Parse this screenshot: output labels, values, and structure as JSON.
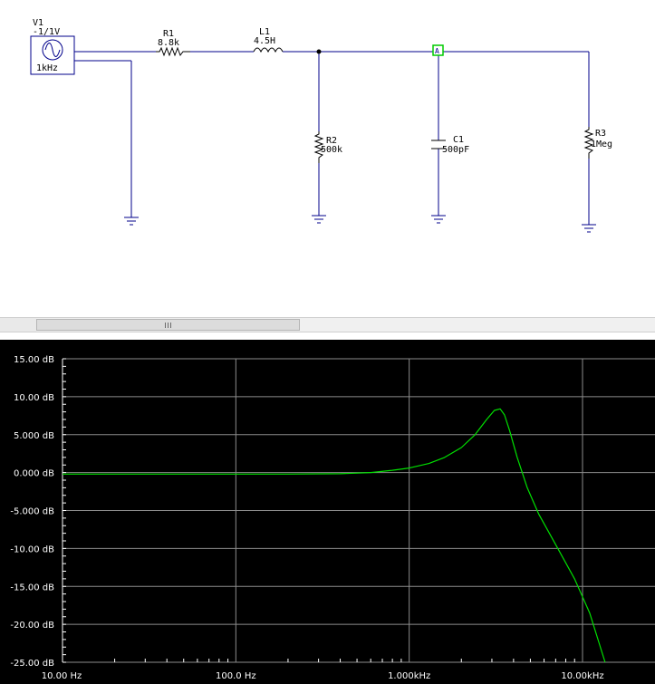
{
  "schematic": {
    "source": {
      "name": "V1",
      "value": "-1/1V",
      "freq": "1kHz"
    },
    "r1": {
      "name": "R1",
      "value": "8.8k"
    },
    "l1": {
      "name": "L1",
      "value": "4.5H"
    },
    "r2": {
      "name": "R2",
      "value": "500k"
    },
    "c1": {
      "name": "C1",
      "value": "500pF"
    },
    "r3": {
      "name": "R3",
      "value": "1Meg"
    },
    "probe": {
      "label": "A",
      "color": "#00cc00"
    },
    "wire_color": "#00008b"
  },
  "chart_data": {
    "type": "line",
    "x_scale": "log",
    "xlim": [
      10,
      15000
    ],
    "ylim": [
      -25,
      15
    ],
    "x_ticks": [
      {
        "value": 10,
        "label": "10.00 Hz"
      },
      {
        "value": 100,
        "label": "100.0 Hz"
      },
      {
        "value": 1000,
        "label": "1.000kHz"
      },
      {
        "value": 10000,
        "label": "10.00kHz"
      }
    ],
    "y_ticks": [
      {
        "value": 15,
        "label": "15.00 dB"
      },
      {
        "value": 10,
        "label": "10.00 dB"
      },
      {
        "value": 5,
        "label": "5.000 dB"
      },
      {
        "value": 0,
        "label": "0.000 dB"
      },
      {
        "value": -5,
        "label": "-5.000 dB"
      },
      {
        "value": -10,
        "label": "-10.00 dB"
      },
      {
        "value": -15,
        "label": "-15.00 dB"
      },
      {
        "value": -20,
        "label": "-20.00 dB"
      },
      {
        "value": -25,
        "label": "-25.00 dB"
      }
    ],
    "grid": true,
    "series": [
      {
        "color": "#00e000",
        "x": [
          10,
          50,
          100,
          200,
          400,
          600,
          800,
          1000,
          1300,
          1600,
          2000,
          2400,
          2800,
          3100,
          3350,
          3550,
          3800,
          4200,
          4800,
          5600,
          7000,
          9000,
          11000,
          13500
        ],
        "y": [
          -0.2,
          -0.2,
          -0.2,
          -0.2,
          -0.15,
          0.0,
          0.3,
          0.6,
          1.2,
          2.0,
          3.3,
          5.0,
          7.0,
          8.2,
          8.4,
          7.6,
          5.5,
          2.0,
          -2.0,
          -5.5,
          -9.5,
          -14.0,
          -18.5,
          -25.0
        ]
      }
    ]
  }
}
